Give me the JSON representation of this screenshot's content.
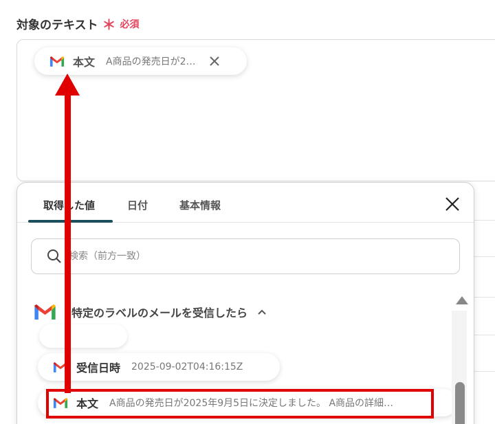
{
  "field": {
    "label": "対象のテキスト",
    "required_mark": "＊",
    "required_text": "必須"
  },
  "selected_chip": {
    "name": "本文",
    "value": "A商品の発売日が2…"
  },
  "panel": {
    "tabs": [
      {
        "label": "取得した値",
        "active": true
      },
      {
        "label": "日付",
        "active": false
      },
      {
        "label": "基本情報",
        "active": false
      }
    ],
    "search": {
      "placeholder": "検索（前方一致）",
      "value": ""
    },
    "group": {
      "title": "特定のラベルのメールを受信したら",
      "expanded": true
    },
    "items": [
      {
        "name": "受信日時",
        "value": "2025-09-02T04:16:15Z"
      },
      {
        "name": "本文",
        "value": "A商品の発売日が2025年9月5日に決定しました。 A商品の詳細…"
      }
    ]
  },
  "colors": {
    "accent_tab": "#1b4f5c",
    "required": "#e2445c",
    "annotation": "#e00000"
  },
  "icons": [
    "gmail-icon",
    "close-icon",
    "search-icon",
    "chevron-up-icon",
    "scroll-up-icon"
  ]
}
